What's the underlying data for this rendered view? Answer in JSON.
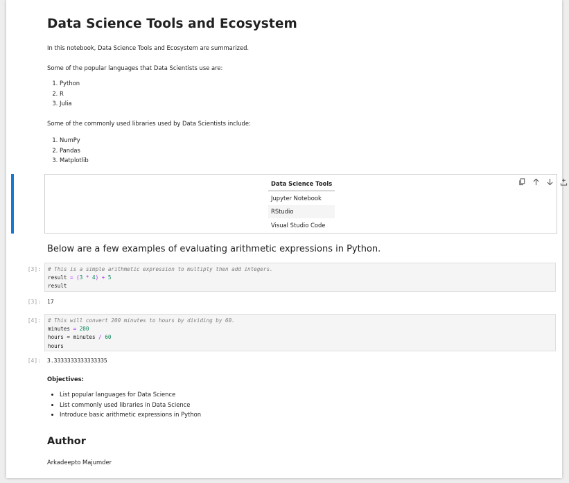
{
  "notebook": {
    "title": "Data Science Tools and Ecosystem",
    "intro": "In this notebook, Data Science Tools and Ecosystem are summarized.",
    "languages_intro": "Some of the popular languages that Data Scientists use are:",
    "languages": [
      "Python",
      "R",
      "Julia"
    ],
    "libraries_intro": "Some of the commonly used libraries used by Data Scientists include:",
    "libraries": [
      "NumPy",
      "Pandas",
      "Matplotlib"
    ],
    "tools_table": {
      "header": "Data Science Tools",
      "rows": [
        "Jupyter Notebook",
        "RStudio",
        "Visual Studio Code"
      ]
    },
    "toolbar_icons": [
      "duplicate-icon",
      "move-up-icon",
      "move-down-icon",
      "insert-above-icon",
      "insert-below-icon",
      "delete-icon"
    ],
    "arithmetic_heading": "Below are a few examples of evaluating arithmetic expressions in Python.",
    "cell3": {
      "prompt": "[3]:",
      "comment": "# This is a simple arithmetic expression to multiply then add integers.",
      "line2_var": "result",
      "line2_eq": " = (",
      "line2_a": "3",
      "line2_mul": " * ",
      "line2_b": "4",
      "line2_close": ") + ",
      "line2_c": "5",
      "line3": "result",
      "output_prompt": "[3]:",
      "output": "17"
    },
    "cell4": {
      "prompt": "[4]:",
      "comment": "# This will convert 200 minutes to hours by dividing by 60.",
      "line2_var": "minutes",
      "line2_eq": " = ",
      "line2_val": "200",
      "line3_var": "hours",
      "line3_eq": " = minutes ",
      "line3_div": "/",
      "line3_val": "60",
      "line4": "hours",
      "output_prompt": "[4]:",
      "output": "3.3333333333333335"
    },
    "objectives_label": "Objectives:",
    "objectives": [
      "List popular languages for Data Science",
      "List commonly used libraries in Data Science",
      "Introduce basic arithmetic expressions in Python"
    ],
    "author_heading": "Author",
    "author_name": "Arkadeepto Majumder"
  },
  "colors": {
    "active_cell": "#1976d2",
    "code_bg": "#f5f5f5",
    "prompt": "#9e9e9e"
  }
}
